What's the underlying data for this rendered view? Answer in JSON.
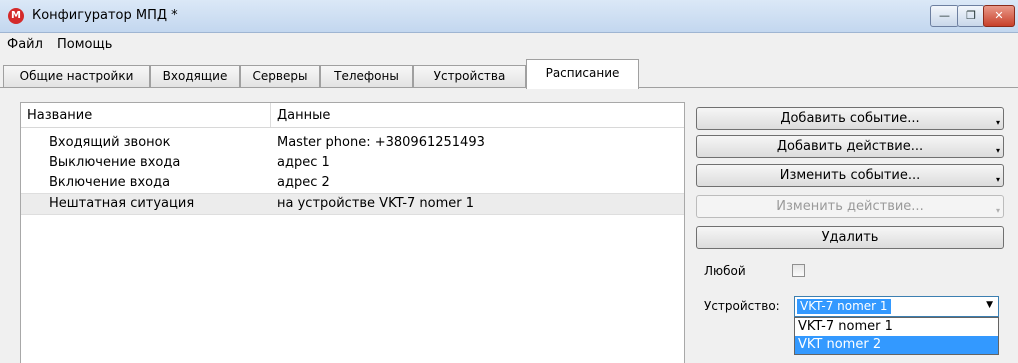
{
  "window": {
    "title": "Конфигуратор МПД *",
    "app_icon_letter": "M",
    "controls": {
      "minimize": "—",
      "maximize": "❐",
      "close": "✕"
    }
  },
  "menu": {
    "items": [
      "Файл",
      "Помощь"
    ]
  },
  "tabs": [
    {
      "label": "Общие настройки",
      "active": false
    },
    {
      "label": "Входящие",
      "active": false
    },
    {
      "label": "Серверы",
      "active": false
    },
    {
      "label": "Телефоны",
      "active": false
    },
    {
      "label": "Устройства",
      "active": false
    },
    {
      "label": "Расписание",
      "active": true
    }
  ],
  "events_list": {
    "columns": [
      "Название",
      "Данные"
    ],
    "rows": [
      {
        "name": "Входящий звонок",
        "data": "Master phone: +380961251493",
        "selected": false
      },
      {
        "name": "Выключение входа",
        "data": "адрес 1",
        "selected": false
      },
      {
        "name": "Включение входа",
        "data": "адрес 2",
        "selected": false
      },
      {
        "name": "Нештатная ситуация",
        "data": "на устройстве VKT-7 nomer  1",
        "selected": true
      }
    ]
  },
  "actions": {
    "add_event": "Добавить событие...",
    "add_action": "Добавить действие...",
    "edit_event": "Изменить событие...",
    "edit_action": "Изменить действие...",
    "delete": "Удалить",
    "drop_arrow": "▾"
  },
  "filter": {
    "any_label": "Любой",
    "any_checked": false,
    "device_label": "Устройство:",
    "device_selected": "VKT-7 nomer  1",
    "combo_arrow": "▼",
    "device_options": [
      "VKT-7 nomer  1",
      "VKT nomer 2"
    ],
    "highlighted_option": "VKT nomer 2"
  },
  "colors": {
    "selection": "#3399ff",
    "close_button": "#c8402a",
    "row_selected": "#ececec"
  }
}
